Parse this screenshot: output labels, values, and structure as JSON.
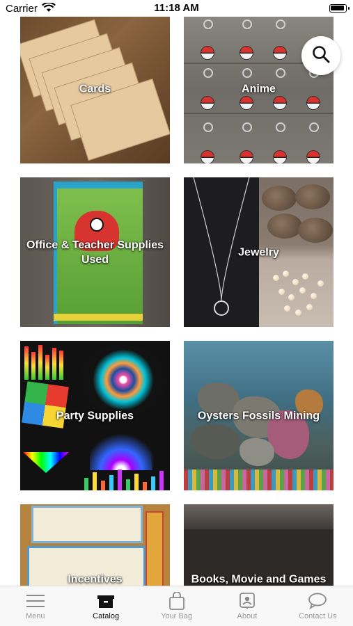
{
  "status_bar": {
    "carrier": "Carrier",
    "time": "11:18 AM"
  },
  "search": {
    "icon": "search-icon"
  },
  "categories": [
    {
      "label": "Cards"
    },
    {
      "label": "Anime"
    },
    {
      "label": "Office & Teacher Supplies Used"
    },
    {
      "label": "Jewelry"
    },
    {
      "label": "Party Supplies"
    },
    {
      "label": "Oysters Fossils Mining"
    },
    {
      "label": "Incentives"
    },
    {
      "label": "Books, Movie and Games"
    }
  ],
  "tab_bar": {
    "items": [
      {
        "label": "Menu",
        "icon": "menu-icon"
      },
      {
        "label": "Catalog",
        "icon": "catalog-icon",
        "active": true
      },
      {
        "label": "Your Bag",
        "icon": "bag-icon"
      },
      {
        "label": "About",
        "icon": "about-icon"
      },
      {
        "label": "Contact Us",
        "icon": "chat-icon"
      }
    ]
  },
  "colors": {
    "active_tab": "#111111",
    "inactive_tab": "#9a9a9a",
    "tab_background": "#f8f8f8"
  }
}
